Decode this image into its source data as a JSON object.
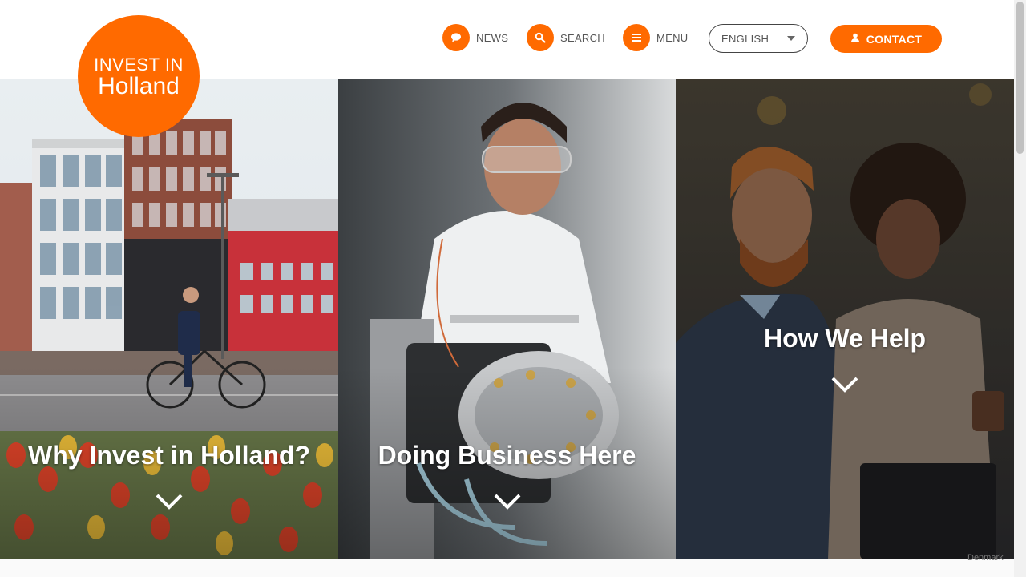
{
  "logo": {
    "line1": "INVEST IN",
    "line2": "Holland"
  },
  "nav": {
    "news": {
      "label": "NEWS",
      "icon": "speech-bubble-icon"
    },
    "search": {
      "label": "SEARCH",
      "icon": "search-icon"
    },
    "menu": {
      "label": "MENU",
      "icon": "hamburger-icon"
    }
  },
  "language": {
    "selected": "ENGLISH"
  },
  "contact": {
    "label": "CONTACT",
    "icon": "person-icon"
  },
  "panels": [
    {
      "title": "Why Invest in Holland?",
      "image": "cyclist-street-tulips"
    },
    {
      "title": "Doing Business Here",
      "image": "scientist-lab-equipment"
    },
    {
      "title": "How We Help",
      "image": "colleagues-laptop"
    }
  ],
  "map": {
    "label": "Denmark"
  },
  "colors": {
    "accent": "#ff6a00"
  }
}
